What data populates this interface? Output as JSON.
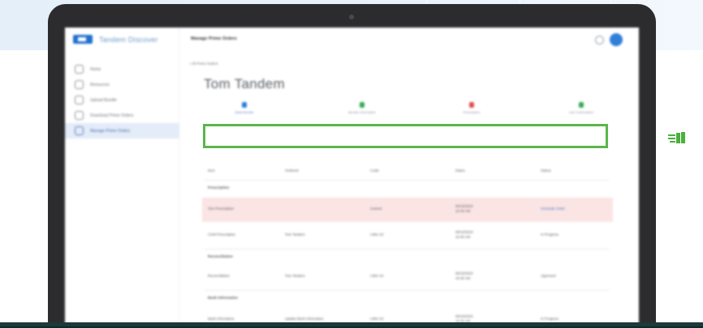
{
  "app": {
    "brand_name": "Tandem Discover",
    "page_heading": "Manage Prime Orders"
  },
  "sidebar": {
    "items": [
      {
        "label": "Home",
        "icon": "home-icon",
        "active": false
      },
      {
        "label": "Resources",
        "icon": "resources-icon",
        "active": false
      },
      {
        "label": "Upload Bundle",
        "icon": "upload-icon",
        "active": false
      },
      {
        "label": "Download Prime Orders",
        "icon": "download-icon",
        "active": false
      },
      {
        "label": "Manage Prime Orders",
        "icon": "orders-icon",
        "active": true
      }
    ]
  },
  "main": {
    "breadcrumb": "‹ All Prime Orders",
    "title": "Tom Tandem",
    "steps": [
      {
        "label": "Build Bundle",
        "color": "#2a7bd6"
      },
      {
        "label": "Bundle Information",
        "color": "#35a853"
      },
      {
        "label": "Prescription",
        "color": "#e04b4b"
      },
      {
        "label": "Lab Confirmation",
        "color": "#35a853"
      }
    ],
    "columns": [
      "Item",
      "Ordered",
      "Code",
      "Dates",
      "Status"
    ],
    "sections": [
      {
        "label": "Prescription",
        "rows": [
          {
            "item": "Tom Prescription",
            "ordered": "",
            "code": "Current",
            "date1": "06/15/2023",
            "date2": "10:45 AM",
            "status": "Generate Order",
            "highlight": true,
            "status_link": true
          },
          {
            "item": "CGM Prescription",
            "ordered": "Tom Tandem",
            "code": "t:slim X2",
            "date1": "06/15/2023",
            "date2": "10:45 AM",
            "status": "In Progress",
            "highlight": false,
            "status_link": false
          }
        ]
      },
      {
        "label": "Reconciliation",
        "rows": [
          {
            "item": "Reconciliation",
            "ordered": "Tom Tandem",
            "code": "t:slim X2",
            "date1": "06/15/2023",
            "date2": "10:45 AM",
            "status": "Approved",
            "highlight": false,
            "status_link": false
          }
        ]
      },
      {
        "label": "Bank Information",
        "rows": [
          {
            "item": "Bank Information",
            "ordered": "Update Bank Information",
            "code": "t:slim X2",
            "date1": "06/15/2023",
            "date2": "10:45 AM",
            "status": "In Progress",
            "highlight": false,
            "status_link": false
          }
        ]
      }
    ]
  },
  "annotation": {
    "highlight_color": "#5cb64b",
    "side_icon": "hand-pointer-icon"
  }
}
